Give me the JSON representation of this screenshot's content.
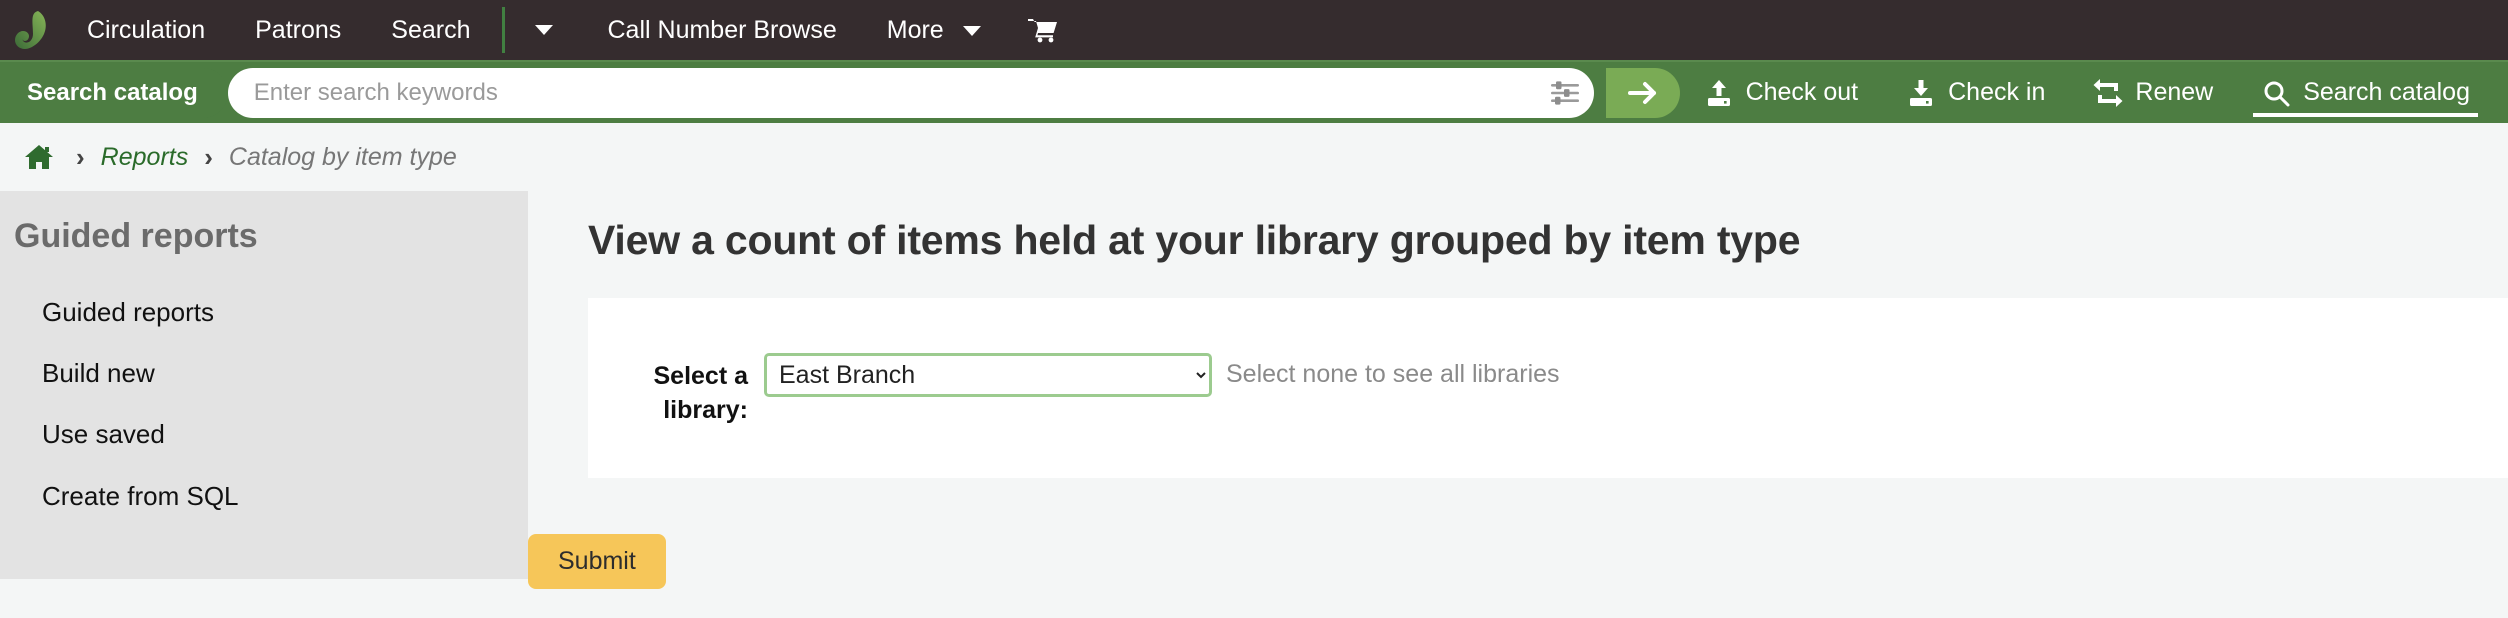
{
  "topnav": {
    "logo_name": "koha-logo",
    "items": [
      {
        "label": "Circulation",
        "name": "nav-item-circulation",
        "caret": false
      },
      {
        "label": "Patrons",
        "name": "nav-item-patrons",
        "caret": false
      },
      {
        "label": "Search",
        "name": "nav-item-search",
        "caret": false
      }
    ],
    "dropdown_caret_label": "",
    "items_after": [
      {
        "label": "Call Number Browse",
        "name": "nav-item-call-number-browse",
        "caret": false
      },
      {
        "label": "More",
        "name": "nav-item-more",
        "caret": true
      }
    ],
    "cart_icon": "cart-icon"
  },
  "search": {
    "tab_label": "Search catalog",
    "placeholder": "Enter search keywords",
    "value": "",
    "filter_icon": "sliders-icon",
    "go_icon": "arrow-right-icon",
    "actions": [
      {
        "label": "Check out",
        "icon": "check-out-icon",
        "name": "search-action-check-out",
        "active": false
      },
      {
        "label": "Check in",
        "icon": "check-in-icon",
        "name": "search-action-check-in",
        "active": false
      },
      {
        "label": "Renew",
        "icon": "renew-icon",
        "name": "search-action-renew",
        "active": false
      },
      {
        "label": "Search catalog",
        "icon": "search-icon",
        "name": "search-action-search-catalog",
        "active": true
      }
    ]
  },
  "breadcrumb": {
    "home_icon": "home-icon",
    "separator": "›",
    "link_label": "Reports",
    "current_label": "Catalog by item type"
  },
  "sidebar": {
    "title": "Guided reports",
    "items": [
      {
        "label": "Guided reports",
        "name": "sidebar-item-guided-reports"
      },
      {
        "label": "Build new",
        "name": "sidebar-item-build-new"
      },
      {
        "label": "Use saved",
        "name": "sidebar-item-use-saved"
      },
      {
        "label": "Create from SQL",
        "name": "sidebar-item-create-from-sql"
      }
    ]
  },
  "main": {
    "title": "View a count of items held at your library grouped by item type",
    "form": {
      "library_label": "Select a library:",
      "library_value": "East Branch",
      "library_options": [
        "East Branch"
      ],
      "hint": "Select none to see all libraries"
    },
    "submit_label": "Submit"
  },
  "colors": {
    "nav_dark": "#352c2e",
    "brand_green": "#4d7d42",
    "accent_green": "#7aab55",
    "link_green": "#2a6b2a",
    "sidebar_grey": "#e3e3e3",
    "page_bg": "#f4f6f6",
    "submit_yellow": "#f6c659",
    "select_border": "#9ccb8f"
  }
}
